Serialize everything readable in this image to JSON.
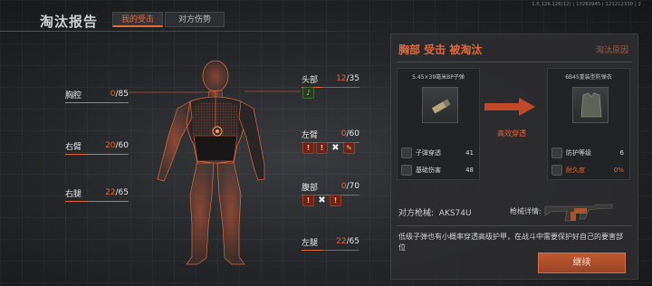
{
  "version": "1.0.126.126(12) | 13260945 | 121212330 | 2",
  "header": {
    "title": "淘汰报告",
    "tabs": [
      {
        "label": "我的受击",
        "active": true
      },
      {
        "label": "对方伤势",
        "active": false
      }
    ]
  },
  "body_parts": {
    "chest": {
      "name": "胸腔",
      "current": "0",
      "max": "/85"
    },
    "right_arm": {
      "name": "右臂",
      "current": "20",
      "max": "/60"
    },
    "right_leg": {
      "name": "右腿",
      "current": "22",
      "max": "/65"
    },
    "head": {
      "name": "头部",
      "current": "12",
      "max": "/35"
    },
    "left_arm": {
      "name": "左臂",
      "current": "0",
      "max": "/60"
    },
    "abdomen": {
      "name": "腹部",
      "current": "0",
      "max": "/70"
    },
    "left_leg": {
      "name": "左腿",
      "current": "22",
      "max": "/65"
    }
  },
  "panel": {
    "title": "胸部 受击 被淘汰",
    "reason_label": "淘汰原因",
    "ammo": {
      "name": "5.45×39毫米BP子弹",
      "stats": [
        {
          "label": "子弹穿透",
          "value": "41"
        },
        {
          "label": "基础伤害",
          "value": "48"
        }
      ]
    },
    "penetration_text": "高效穿透",
    "armor": {
      "name": "6B45重装型防弹衣",
      "stats": [
        {
          "label": "防护等级",
          "value": "6",
          "warn": false
        },
        {
          "label": "耐久度",
          "value": "0%",
          "warn": true
        }
      ]
    },
    "weapon_label": "对方枪械:",
    "weapon_name": "AKS74U",
    "weapon_detail": "枪械详情:",
    "tip": "低级子弹也有小概率穿透高级护甲，在战斗中需要保护好自己的要害部位",
    "continue_label": "继续"
  },
  "colors": {
    "accent": "#e2673a",
    "body_glow": "#d85a34"
  }
}
